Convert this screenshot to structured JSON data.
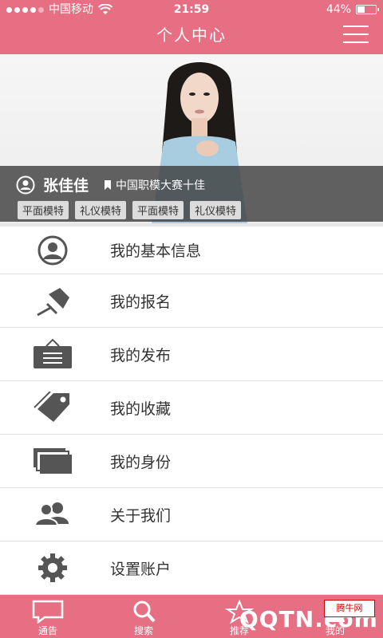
{
  "status": {
    "carrier": "中国移动",
    "time": "21:59",
    "battery": "44%",
    "battery_level": 0.44
  },
  "header": {
    "title": "个人中心"
  },
  "profile": {
    "name": "张佳佳",
    "honor": "中国职模大赛十佳",
    "tags": [
      "平面模特",
      "礼仪模特",
      "平面模特",
      "礼仪模特"
    ]
  },
  "menu": {
    "items": [
      {
        "label": "我的基本信息",
        "icon": "user-circle-icon"
      },
      {
        "label": "我的报名",
        "icon": "pin-icon"
      },
      {
        "label": "我的发布",
        "icon": "board-icon"
      },
      {
        "label": "我的收藏",
        "icon": "tag-icon"
      },
      {
        "label": "我的身份",
        "icon": "cards-icon"
      },
      {
        "label": "关于我们",
        "icon": "people-icon"
      },
      {
        "label": "设置账户",
        "icon": "gear-icon"
      }
    ]
  },
  "tabbar": {
    "tabs": [
      {
        "label": "通告",
        "icon": "chat-icon"
      },
      {
        "label": "搜索",
        "icon": "search-icon"
      },
      {
        "label": "推荐",
        "icon": "star-icon"
      },
      {
        "label": "我的",
        "icon": "user-icon"
      }
    ],
    "watermark_logo": "腾牛网",
    "watermark_text": "QQTN.com"
  },
  "colors": {
    "accent": "#e76f83",
    "icon": "#555555"
  }
}
